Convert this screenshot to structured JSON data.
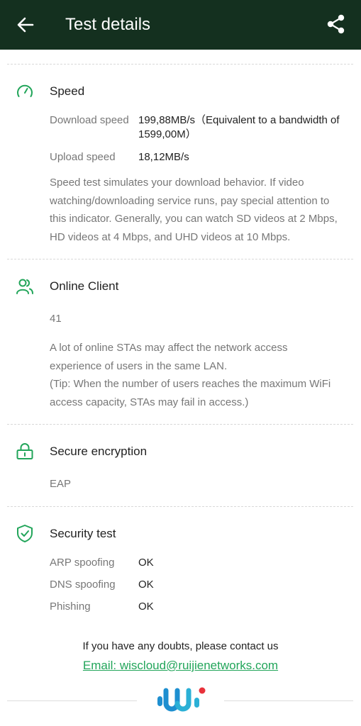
{
  "header": {
    "title": "Test details",
    "back_icon": "arrow-left-icon",
    "share_icon": "share-icon",
    "background": "#14301f"
  },
  "accent_color": "#22a55a",
  "speed": {
    "title": "Speed",
    "icon": "speedometer-icon",
    "download_label": "Download speed",
    "download_value_line1": "199,88MB/s（Equivalent to a bandwidth of",
    "download_value_line2": "1599,00M）",
    "upload_label": "Upload speed",
    "upload_value": "18,12MB/s",
    "desc_lines": [
      "Speed test simulates your download behavior. If video",
      "watching/downloading service runs, pay special attention to",
      "this indicator. Generally, you can watch SD videos at 2 Mbps,",
      "HD videos at 4 Mbps, and UHD videos at 10 Mbps."
    ]
  },
  "online_client": {
    "title": "Online Client",
    "icon": "users-icon",
    "count": "41",
    "desc_lines": [
      "A lot of online STAs may affect the network access",
      "experience of users in the same LAN.",
      "(Tip: When the number of users reaches the maximum WiFi",
      "access capacity, STAs may fail in access.)"
    ]
  },
  "secure_encryption": {
    "title": "Secure encryption",
    "icon": "lock-icon",
    "value": "EAP"
  },
  "security_test": {
    "title": "Security test",
    "icon": "shield-check-icon",
    "rows": [
      {
        "label": "ARP spoofing",
        "value": "OK"
      },
      {
        "label": "DNS spoofing",
        "value": "OK"
      },
      {
        "label": "Phishing",
        "value": "OK"
      }
    ]
  },
  "footer": {
    "contact_text": "If you have any doubts, please contact us",
    "email_text": "Email: wiscloud@ruijienetworks.com",
    "logo_icon": "wis-logo-icon"
  }
}
